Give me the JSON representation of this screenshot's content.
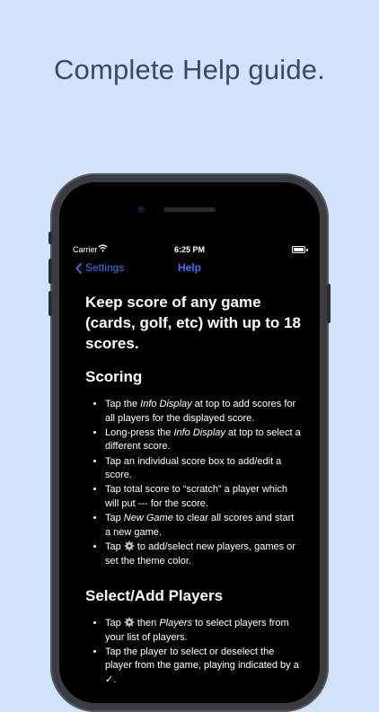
{
  "headline": "Complete Help guide.",
  "status_bar": {
    "carrier": "Carrier",
    "time": "6:25 PM"
  },
  "nav": {
    "back_label": "Settings",
    "title": "Help"
  },
  "intro": "Keep score of any game (cards, golf, etc) with up to 18 scores.",
  "scoring": {
    "title": "Scoring",
    "items": [
      {
        "a": "Tap the ",
        "em": "Info Display",
        "b": " at top to add scores for all players for the displayed score."
      },
      {
        "a": "Long-press the ",
        "em": "Info Display",
        "b": " at top to select a different score."
      },
      {
        "a": "Tap an individual score box to add/edit a score.",
        "em": "",
        "b": ""
      },
      {
        "a": "Tap total score to “scratch” a player which will put --- for the score.",
        "em": "",
        "b": ""
      },
      {
        "a": "Tap ",
        "em": "New Game",
        "b": " to clear all scores and start a new game."
      },
      {
        "a": "Tap ",
        "gear": true,
        "b": " to add/select new players, games or set the theme color."
      }
    ]
  },
  "players": {
    "title": "Select/Add Players",
    "items": [
      {
        "a": "Tap ",
        "gear": true,
        "b": " then ",
        "em": "Players",
        "c": " to select players from your list of players."
      },
      {
        "a": "Tap the player to select or deselect the player from the game, playing indicated by a ✓.",
        "em": "",
        "b": ""
      }
    ]
  },
  "icons": {
    "back": "chevron-left-icon",
    "gear": "gear-icon",
    "wifi": "wifi-icon",
    "battery": "battery-icon"
  },
  "colors": {
    "accent": "#3478f6",
    "background": "#d3e2fb",
    "screen": "#000000"
  }
}
